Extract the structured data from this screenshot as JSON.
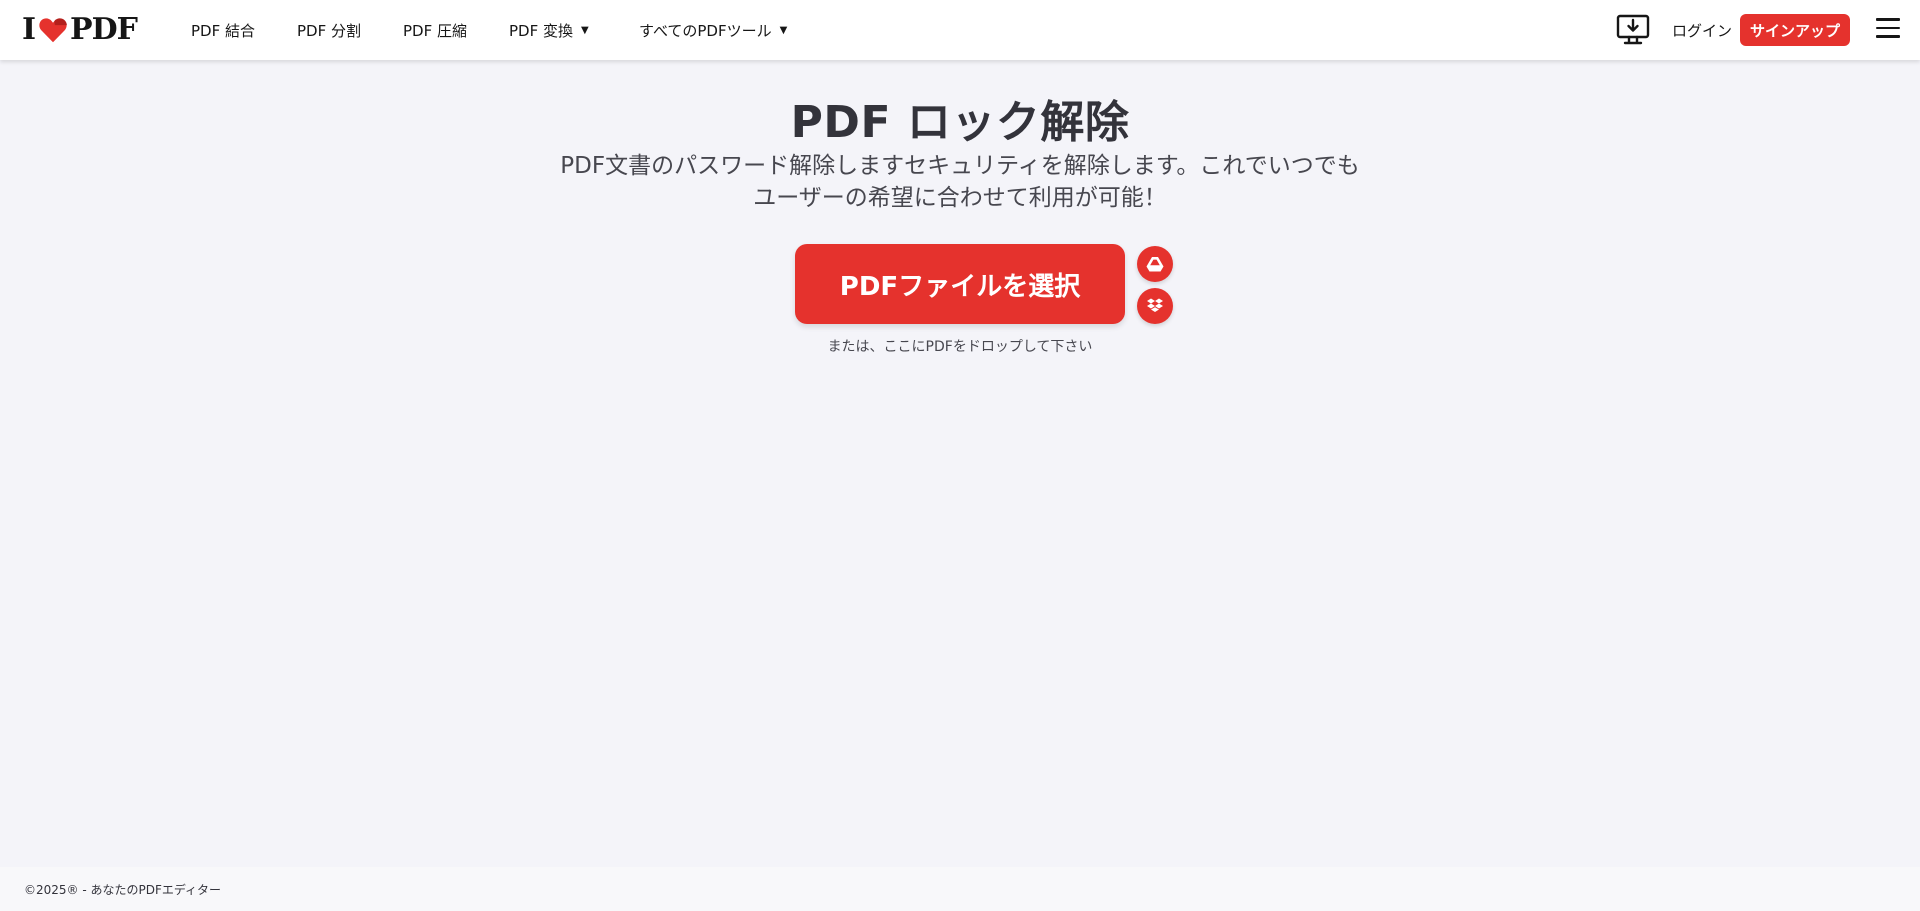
{
  "header": {
    "logo": {
      "left": "I",
      "right": "PDF"
    },
    "nav": [
      {
        "label": "PDF 結合"
      },
      {
        "label": "PDF 分割"
      },
      {
        "label": "PDF 圧縮"
      },
      {
        "label": "PDF 変換"
      },
      {
        "label": "すべてのPDFツール"
      }
    ],
    "login_label": "ログイン",
    "signup_label": "サインアップ"
  },
  "main": {
    "title": "PDF ロック解除",
    "subtitle": "PDF文書のパスワード解除しますセキュリティを解除します。これでいつでもユーザーの希望に合わせて利用が可能！",
    "select_button_label": "PDFファイルを選択",
    "drop_hint": "または、ここにPDFをドロップして下さい"
  },
  "footer": {
    "copyright": "©2025® - あなたのPDFエディター"
  },
  "icons": {
    "logo": "heart-icon",
    "desktop": "desktop-download-icon",
    "menu": "hamburger-menu-icon",
    "gdrive": "google-drive-icon",
    "dropbox": "dropbox-icon",
    "caret": "caret-down-icon"
  },
  "colors": {
    "accent": "#e5322d",
    "background": "#f4f4f9",
    "header_bg": "#ffffff",
    "text": "#33333b"
  }
}
